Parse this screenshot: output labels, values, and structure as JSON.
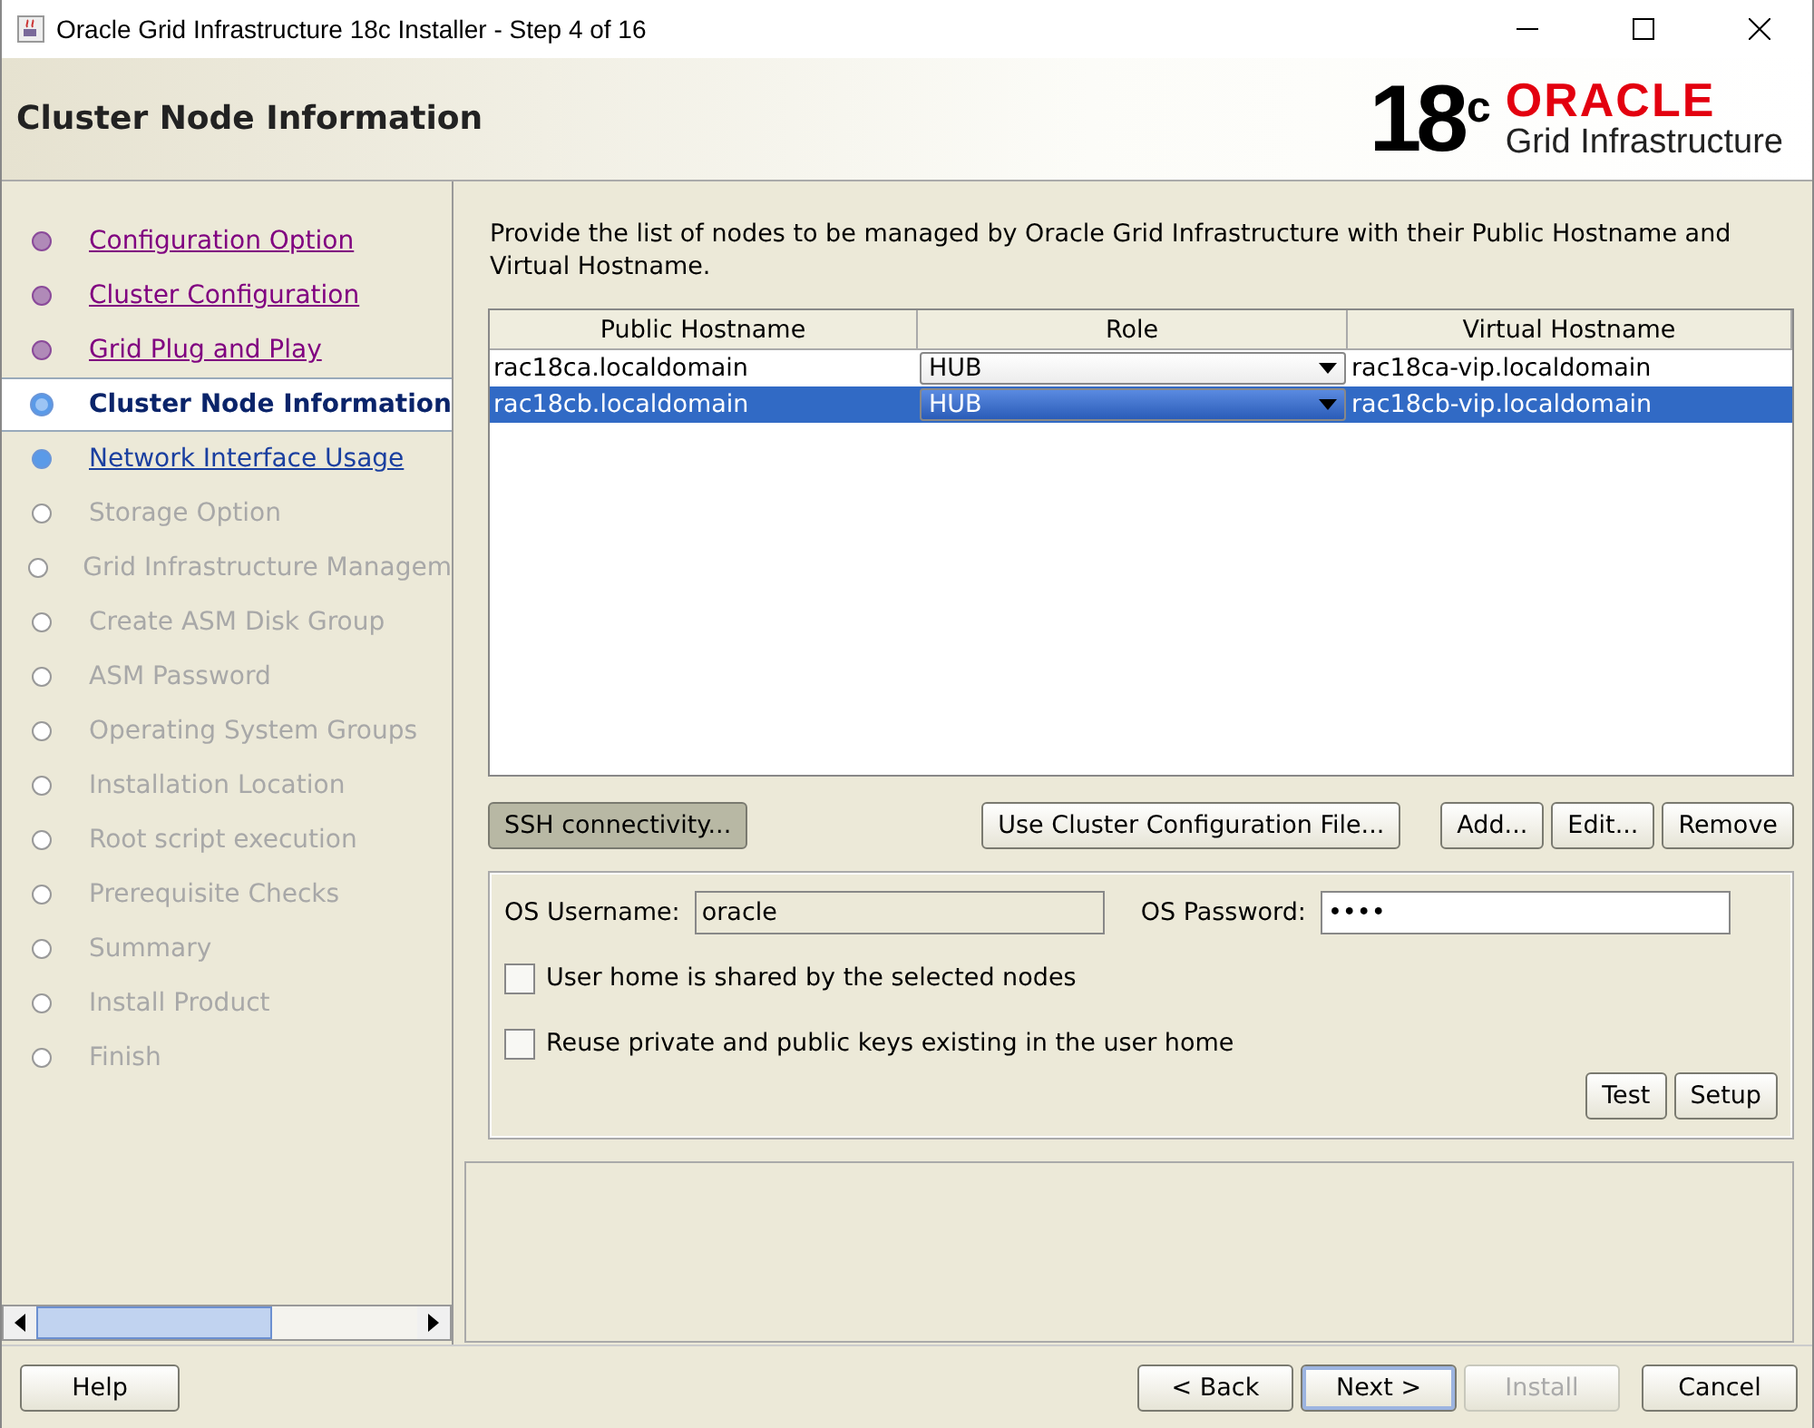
{
  "window": {
    "title": "Oracle Grid Infrastructure 18c Installer - Step 4 of 16"
  },
  "header": {
    "title": "Cluster Node Information",
    "logo_version": "18",
    "logo_superscript": "c",
    "logo_brand": "ORACLE",
    "logo_product": "Grid Infrastructure"
  },
  "steps": [
    {
      "label": "Configuration Option",
      "visited": true,
      "selected": false,
      "disabled": false
    },
    {
      "label": "Cluster Configuration",
      "visited": true,
      "selected": false,
      "disabled": false
    },
    {
      "label": "Grid Plug and Play",
      "visited": true,
      "selected": false,
      "disabled": false
    },
    {
      "label": "Cluster Node Information",
      "visited": false,
      "selected": true,
      "disabled": false
    },
    {
      "label": "Network Interface Usage",
      "visited": false,
      "selected": false,
      "disabled": false
    },
    {
      "label": "Storage Option",
      "visited": false,
      "selected": false,
      "disabled": true
    },
    {
      "label": "Grid Infrastructure Managem",
      "visited": false,
      "selected": false,
      "disabled": true
    },
    {
      "label": "Create ASM Disk Group",
      "visited": false,
      "selected": false,
      "disabled": true
    },
    {
      "label": "ASM Password",
      "visited": false,
      "selected": false,
      "disabled": true
    },
    {
      "label": "Operating System Groups",
      "visited": false,
      "selected": false,
      "disabled": true
    },
    {
      "label": "Installation Location",
      "visited": false,
      "selected": false,
      "disabled": true
    },
    {
      "label": "Root script execution",
      "visited": false,
      "selected": false,
      "disabled": true
    },
    {
      "label": "Prerequisite Checks",
      "visited": false,
      "selected": false,
      "disabled": true
    },
    {
      "label": "Summary",
      "visited": false,
      "selected": false,
      "disabled": true
    },
    {
      "label": "Install Product",
      "visited": false,
      "selected": false,
      "disabled": true
    },
    {
      "label": "Finish",
      "visited": false,
      "selected": false,
      "disabled": true
    }
  ],
  "instructions": "Provide the list of nodes to be managed by Oracle Grid Infrastructure with their Public Hostname and Virtual Hostname.",
  "table": {
    "columns": [
      "Public Hostname",
      "Role",
      "Virtual Hostname"
    ],
    "rows": [
      {
        "public_hostname": "rac18ca.localdomain",
        "role": "HUB",
        "virtual_hostname": "rac18ca-vip.localdomain",
        "selected": false
      },
      {
        "public_hostname": "rac18cb.localdomain",
        "role": "HUB",
        "virtual_hostname": "rac18cb-vip.localdomain",
        "selected": true
      }
    ]
  },
  "table_buttons": [
    {
      "label": "SSH connectivity...",
      "pressed": true
    },
    {
      "label": "Use Cluster Configuration File...",
      "pressed": false
    },
    {
      "label": "Add...",
      "pressed": false
    },
    {
      "label": "Edit...",
      "pressed": false
    },
    {
      "label": "Remove",
      "pressed": false
    }
  ],
  "ssh": {
    "username_label": "OS Username:",
    "username": "oracle",
    "password_label": "OS Password:",
    "password": "••••",
    "options": [
      {
        "label": "User home is shared by the selected nodes",
        "checked": false
      },
      {
        "label": "Reuse private and public keys existing in the user home",
        "checked": false
      }
    ],
    "buttons": [
      "Test",
      "Setup"
    ]
  },
  "footer": {
    "help": "Help",
    "buttons": [
      {
        "label": "< Back",
        "disabled": false,
        "default": false
      },
      {
        "label": "Next >",
        "disabled": false,
        "default": true
      },
      {
        "label": "Install",
        "disabled": true,
        "default": false
      },
      {
        "label": "Cancel",
        "disabled": false,
        "default": false
      }
    ]
  }
}
